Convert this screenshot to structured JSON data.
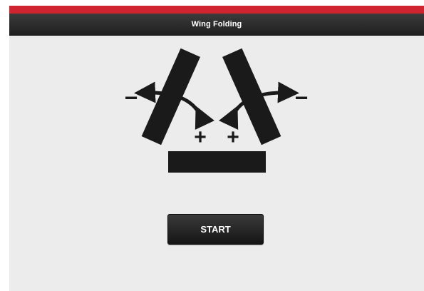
{
  "header": {
    "title": "Wing Folding"
  },
  "diagram": {
    "plus_symbol": "+",
    "minus_symbol": "−",
    "icon": "wing-folding-diagram-icon"
  },
  "actions": {
    "start_label": "START"
  },
  "colors": {
    "accent_red": "#d02431",
    "title_bar": "#2a2a2a",
    "background": "#ececec",
    "shape_black": "#1a1a1a",
    "text_white": "#ffffff"
  }
}
